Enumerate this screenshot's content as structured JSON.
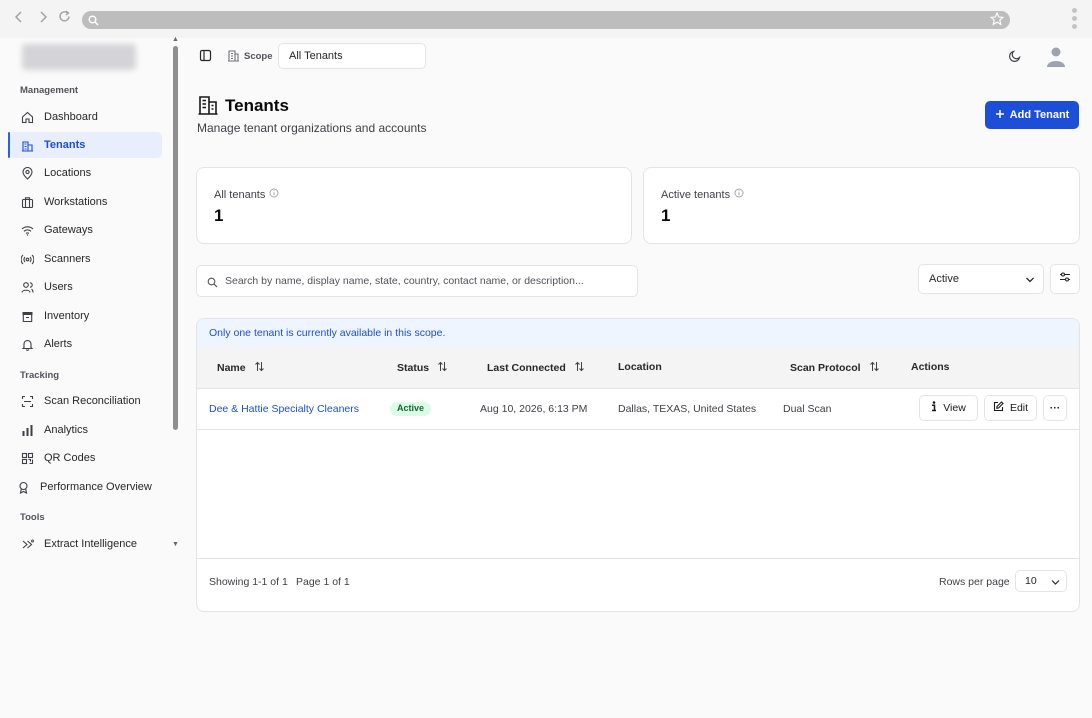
{
  "sidebar": {
    "sections": {
      "management": "Management",
      "tracking": "Tracking",
      "tools": "Tools"
    },
    "items": [
      {
        "label": "Dashboard",
        "icon": "home-icon"
      },
      {
        "label": "Tenants",
        "icon": "building-icon",
        "active": true
      },
      {
        "label": "Locations",
        "icon": "map-pin-icon"
      },
      {
        "label": "Workstations",
        "icon": "briefcase-icon"
      },
      {
        "label": "Gateways",
        "icon": "wifi-icon"
      },
      {
        "label": "Scanners",
        "icon": "radio-icon"
      },
      {
        "label": "Users",
        "icon": "users-icon"
      },
      {
        "label": "Inventory",
        "icon": "archive-icon"
      },
      {
        "label": "Alerts",
        "icon": "bell-icon"
      },
      {
        "label": "Scan Reconciliation",
        "icon": "scan-icon"
      },
      {
        "label": "Analytics",
        "icon": "bar-chart-icon"
      },
      {
        "label": "QR Codes",
        "icon": "qr-code-icon"
      },
      {
        "label": "Performance Overview",
        "icon": "award-icon"
      },
      {
        "label": "Extract Intelligence",
        "icon": "chevrons-icon"
      }
    ]
  },
  "topbar": {
    "scope_label": "Scope",
    "scope_value": "All Tenants"
  },
  "header": {
    "title": "Tenants",
    "subtitle": "Manage tenant organizations and accounts",
    "add_button": "Add Tenant"
  },
  "stats": {
    "all_label": "All tenants",
    "all_value": "1",
    "active_label": "Active tenants",
    "active_value": "1"
  },
  "filters": {
    "search_placeholder": "Search by name, display name, state, country, contact name, or description...",
    "status_value": "Active"
  },
  "table": {
    "notice": "Only one tenant is currently available in this scope.",
    "columns": [
      "Name",
      "Status",
      "Last Connected",
      "Location",
      "Scan Protocol",
      "Actions"
    ],
    "rows": [
      {
        "name": "Dee & Hattie Specialty Cleaners",
        "status": "Active",
        "last_connected": "Aug 10, 2026, 6:13 PM",
        "location": "Dallas, TEXAS, United States",
        "scan_protocol": "Dual Scan"
      }
    ],
    "view_label": "View",
    "edit_label": "Edit",
    "more_label": "···"
  },
  "footer": {
    "showing": "Showing 1-1 of 1",
    "page": "Page 1 of 1",
    "rows_per_page_label": "Rows per page",
    "rows_per_page_value": "10"
  },
  "colors": {
    "accent": "#1d4ed8",
    "active_badge_bg": "#dcfce7",
    "active_badge_text": "#166534"
  }
}
